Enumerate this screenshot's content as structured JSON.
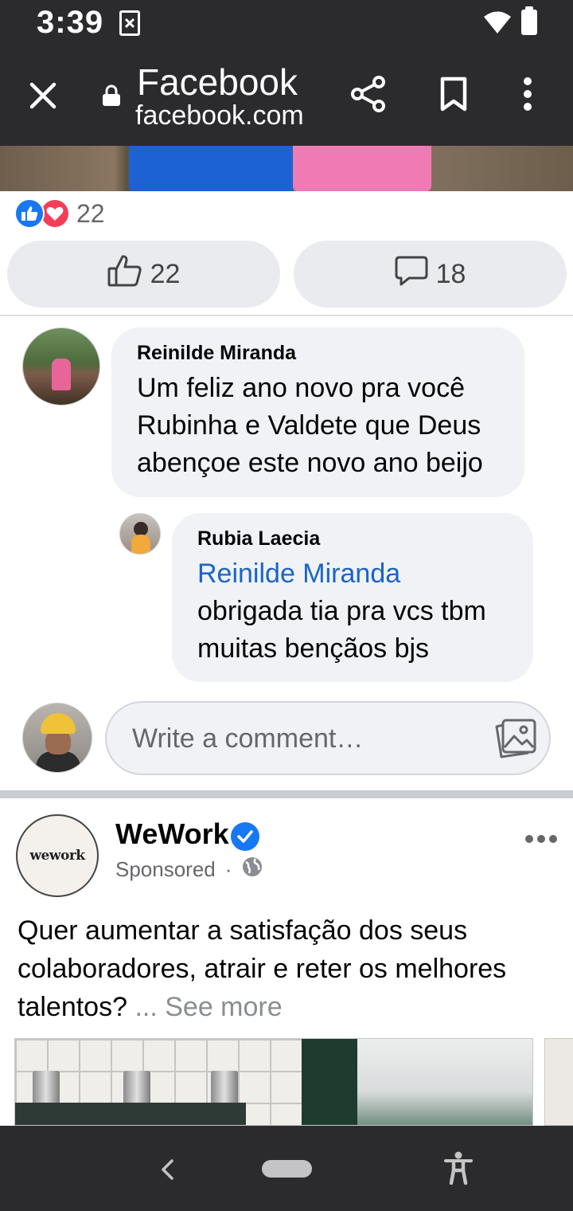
{
  "status_bar": {
    "time": "3:39",
    "icons": [
      "notification-icon",
      "wifi-icon",
      "battery-icon"
    ]
  },
  "browser": {
    "title": "Facebook",
    "url": "facebook.com",
    "icons": [
      "close-icon",
      "lock-icon",
      "share-icon",
      "bookmark-icon",
      "more-vert-icon"
    ]
  },
  "post": {
    "reaction_count": "22",
    "like_count": "22",
    "comment_count": "18"
  },
  "comments": [
    {
      "author": "Reinilde Miranda",
      "text_lines": [
        "Um feliz ano novo pra você",
        "Rubinha e Valdete que Deus",
        "abençoe este novo ano beijo"
      ]
    },
    {
      "author": "Rubia Laecia",
      "mention": "Reinilde Miranda",
      "text_lines": [
        "obrigada tia pra vcs tbm",
        "muitas bençãos bjs"
      ]
    }
  ],
  "comment_input": {
    "placeholder": "Write a comment…"
  },
  "sponsored_post": {
    "logo_text": "wework",
    "name": "WeWork",
    "meta": "Sponsored",
    "separator": "·",
    "text": "Quer aumentar a satisfação dos seus colaboradores, atrair e reter os melhores talentos?",
    "ellipsis": " ... ",
    "see_more": "See more"
  },
  "colors": {
    "brand_blue": "#1877f2",
    "love_red": "#f33e58",
    "bubble_bg": "#f0f2f5",
    "mention_blue": "#1b64c8",
    "chrome_dark": "#2b2b2d"
  }
}
